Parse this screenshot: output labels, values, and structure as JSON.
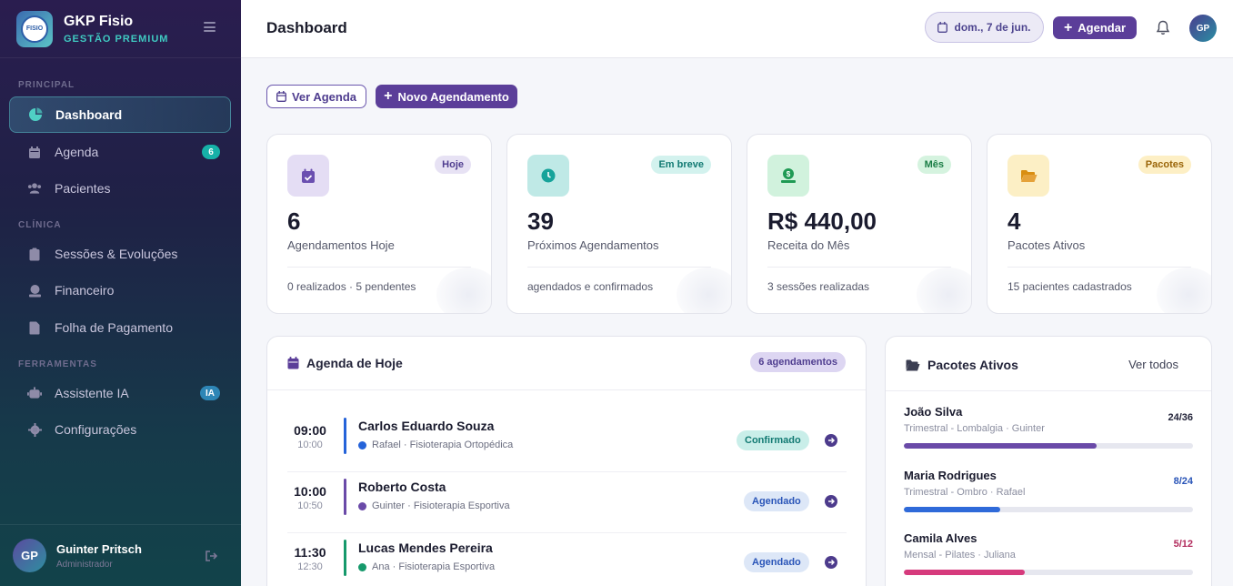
{
  "brand": {
    "name": "GKP Fisio",
    "subtitle": "GESTÃO PREMIUM",
    "logo_text": "FISIO"
  },
  "sidebar": {
    "sections": {
      "principal": "PRINCIPAL",
      "clinica": "CLÍNICA",
      "ferramentas": "FERRAMENTAS"
    },
    "items": [
      {
        "label": "Dashboard",
        "icon": "chart-pie-icon"
      },
      {
        "label": "Agenda",
        "icon": "calendar-icon",
        "badge": "6",
        "badge_color": "#16b1a8"
      },
      {
        "label": "Pacientes",
        "icon": "users-icon"
      },
      {
        "label": "Sessões & Evoluções",
        "icon": "clipboard-icon"
      },
      {
        "label": "Financeiro",
        "icon": "money-bill-icon"
      },
      {
        "label": "Folha de Pagamento",
        "icon": "file-invoice-icon"
      },
      {
        "label": "Assistente IA",
        "icon": "robot-icon",
        "badge": "IA",
        "badge_color": "#2e86b6"
      },
      {
        "label": "Configurações",
        "icon": "gear-icon"
      }
    ],
    "user": {
      "initials": "GP",
      "name": "Guinter Pritsch",
      "role": "Administrador"
    }
  },
  "header": {
    "title": "Dashboard",
    "date": "dom., 7 de jun.",
    "schedule_label": "Agendar",
    "avatar_initials": "GP"
  },
  "actions": {
    "view_schedule": "Ver Agenda",
    "new_appointment": "Novo Agendamento"
  },
  "stats": [
    {
      "chip": "Hoje",
      "value": "6",
      "label": "Agendamentos Hoje",
      "footer": "0 realizados · 5 pendentes",
      "icon": "calendar-check-icon",
      "color": "#6a4fb0"
    },
    {
      "chip": "Em breve",
      "value": "39",
      "label": "Próximos Agendamentos",
      "footer": "agendados e confirmados",
      "icon": "clock-icon",
      "color": "#16a39a"
    },
    {
      "chip": "Mês",
      "value": "R$ 440,00",
      "label": "Receita do Mês",
      "footer": "3 sessões realizadas",
      "icon": "money-icon",
      "color": "#1f9a54"
    },
    {
      "chip": "Pacotes",
      "value": "4",
      "label": "Pacotes Ativos",
      "footer": "15 pacientes cadastrados",
      "icon": "folder-open-icon",
      "color": "#d98e12"
    }
  ],
  "agenda": {
    "title": "Agenda de Hoje",
    "count": "6 agendamentos",
    "items": [
      {
        "start": "09:00",
        "end": "10:00",
        "patient": "Carlos Eduardo Souza",
        "therapist": "Rafael · Fisioterapia Ortopédica",
        "status": "Confirmado",
        "color": "#2563d9"
      },
      {
        "start": "10:00",
        "end": "10:50",
        "patient": "Roberto Costa",
        "therapist": "Guinter · Fisioterapia Esportiva",
        "status": "Agendado",
        "color": "#6a4aa8"
      },
      {
        "start": "11:30",
        "end": "12:30",
        "patient": "Lucas Mendes Pereira",
        "therapist": "Ana · Fisioterapia Esportiva",
        "status": "Agendado",
        "color": "#16996b"
      }
    ]
  },
  "packages": {
    "title": "Pacotes Ativos",
    "view_all": "Ver todos",
    "items": [
      {
        "name": "João Silva",
        "desc": "Trimestral - Lombalgia · Guinter",
        "count": "24/36",
        "progress": 0.667,
        "color": "#6a4aa8",
        "count_color": "#23243a"
      },
      {
        "name": "Maria Rodrigues",
        "desc": "Trimestral - Ombro · Rafael",
        "count": "8/24",
        "progress": 0.333,
        "color": "#2f6ad9",
        "count_color": "#2a55b8"
      },
      {
        "name": "Camila Alves",
        "desc": "Mensal - Pilates · Juliana",
        "count": "5/12",
        "progress": 0.417,
        "color": "#d63a7c",
        "count_color": "#b22c5d"
      }
    ]
  }
}
